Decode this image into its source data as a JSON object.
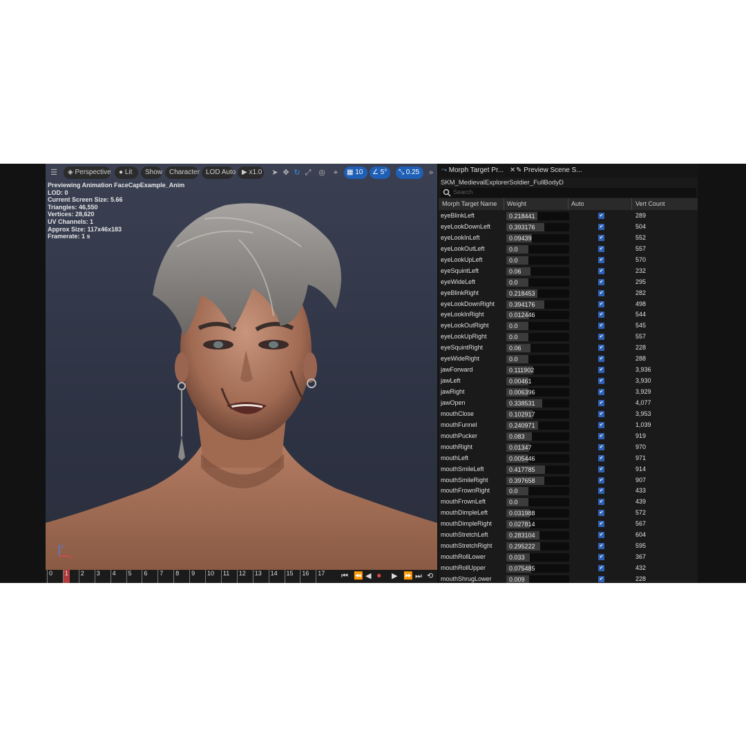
{
  "viewport": {
    "toolbar": {
      "perspective": "Perspective",
      "lit": "Lit",
      "show": "Show",
      "character": "Character",
      "lod": "LOD Auto",
      "speed": "x1.0",
      "grid_snap": "10",
      "rotation_snap": "5°",
      "scale_snap": "0.25"
    },
    "stats": [
      "Previewing Animation FaceCapExample_Anim",
      "LOD: 0",
      "Current Screen Size: 5.66",
      "Triangles: 46,550",
      "Vertices: 28,620",
      "UV Channels: 1",
      "Approx Size: 117x46x183",
      "Framerate: 1 s"
    ],
    "axis": {
      "z": "z",
      "x": "x"
    }
  },
  "timeline": {
    "frames": [
      "0",
      "1",
      "2",
      "3",
      "4",
      "5",
      "6",
      "7",
      "8",
      "9",
      "10",
      "11",
      "12",
      "13",
      "14",
      "15",
      "16",
      "17"
    ],
    "current_frame": 1
  },
  "panel": {
    "tabs": {
      "morph": "Morph Target Pr...",
      "preview": "Preview Scene S..."
    },
    "asset_name": "SKM_MedievalExplorerSoldier_FullBodyD",
    "search_placeholder": "Search",
    "columns": {
      "name": "Morph Target Name",
      "weight": "Weight",
      "auto": "Auto",
      "vert": "Vert Count"
    },
    "rows": [
      {
        "name": "eyeBlinkLeft",
        "weight": "0.218441",
        "auto": true,
        "verts": "289"
      },
      {
        "name": "eyeLookDownLeft",
        "weight": "0.393176",
        "auto": true,
        "verts": "504"
      },
      {
        "name": "eyeLookInLeft",
        "weight": "0.09439",
        "auto": true,
        "verts": "552"
      },
      {
        "name": "eyeLookOutLeft",
        "weight": "0.0",
        "auto": true,
        "verts": "557"
      },
      {
        "name": "eyeLookUpLeft",
        "weight": "0.0",
        "auto": true,
        "verts": "570"
      },
      {
        "name": "eyeSquintLeft",
        "weight": "0.06",
        "auto": true,
        "verts": "232"
      },
      {
        "name": "eyeWideLeft",
        "weight": "0.0",
        "auto": true,
        "verts": "295"
      },
      {
        "name": "eyeBlinkRight",
        "weight": "0.218453",
        "auto": true,
        "verts": "282"
      },
      {
        "name": "eyeLookDownRight",
        "weight": "0.394176",
        "auto": true,
        "verts": "498"
      },
      {
        "name": "eyeLookInRight",
        "weight": "0.012446",
        "auto": true,
        "verts": "544"
      },
      {
        "name": "eyeLookOutRight",
        "weight": "0.0",
        "auto": true,
        "verts": "545"
      },
      {
        "name": "eyeLookUpRight",
        "weight": "0.0",
        "auto": true,
        "verts": "557"
      },
      {
        "name": "eyeSquintRight",
        "weight": "0.06",
        "auto": true,
        "verts": "228"
      },
      {
        "name": "eyeWideRight",
        "weight": "0.0",
        "auto": true,
        "verts": "288"
      },
      {
        "name": "jawForward",
        "weight": "0.111902",
        "auto": true,
        "verts": "3,936"
      },
      {
        "name": "jawLeft",
        "weight": "0.00461",
        "auto": true,
        "verts": "3,930"
      },
      {
        "name": "jawRight",
        "weight": "0.006396",
        "auto": true,
        "verts": "3,929"
      },
      {
        "name": "jawOpen",
        "weight": "0.338531",
        "auto": true,
        "verts": "4,077"
      },
      {
        "name": "mouthClose",
        "weight": "0.102917",
        "auto": true,
        "verts": "3,953"
      },
      {
        "name": "mouthFunnel",
        "weight": "0.240971",
        "auto": true,
        "verts": "1,039"
      },
      {
        "name": "mouthPucker",
        "weight": "0.083",
        "auto": true,
        "verts": "919"
      },
      {
        "name": "mouthRight",
        "weight": "0.01347",
        "auto": true,
        "verts": "970"
      },
      {
        "name": "mouthLeft",
        "weight": "0.005446",
        "auto": true,
        "verts": "971"
      },
      {
        "name": "mouthSmileLeft",
        "weight": "0.417785",
        "auto": true,
        "verts": "914"
      },
      {
        "name": "mouthSmileRight",
        "weight": "0.397658",
        "auto": true,
        "verts": "907"
      },
      {
        "name": "mouthFrownRight",
        "weight": "0.0",
        "auto": true,
        "verts": "433"
      },
      {
        "name": "mouthFrownLeft",
        "weight": "0.0",
        "auto": true,
        "verts": "439"
      },
      {
        "name": "mouthDimpleLeft",
        "weight": "0.031988",
        "auto": true,
        "verts": "572"
      },
      {
        "name": "mouthDimpleRight",
        "weight": "0.027814",
        "auto": true,
        "verts": "567"
      },
      {
        "name": "mouthStretchLeft",
        "weight": "0.283104",
        "auto": true,
        "verts": "604"
      },
      {
        "name": "mouthStretchRight",
        "weight": "0.295222",
        "auto": true,
        "verts": "595"
      },
      {
        "name": "mouthRollLower",
        "weight": "0.033",
        "auto": true,
        "verts": "367"
      },
      {
        "name": "mouthRollUpper",
        "weight": "0.075485",
        "auto": true,
        "verts": "432"
      },
      {
        "name": "mouthShrugLower",
        "weight": "0.009",
        "auto": true,
        "verts": "228"
      }
    ]
  },
  "colors": {
    "accent": "#1f5fb5",
    "checkbox": "#2f62b5",
    "playhead": "#b03a3a"
  },
  "icons": [
    "menu-icon",
    "perspective-cube-icon",
    "lit-sphere-icon",
    "play-icon",
    "select-arrow-icon",
    "move-icon",
    "rotate-icon",
    "scale-icon",
    "world-icon",
    "surface-snap-icon",
    "grid-icon",
    "angle-icon",
    "scale-snap-icon",
    "more-icon",
    "search-icon",
    "morph-target-icon",
    "preview-scene-icon",
    "close-icon"
  ]
}
